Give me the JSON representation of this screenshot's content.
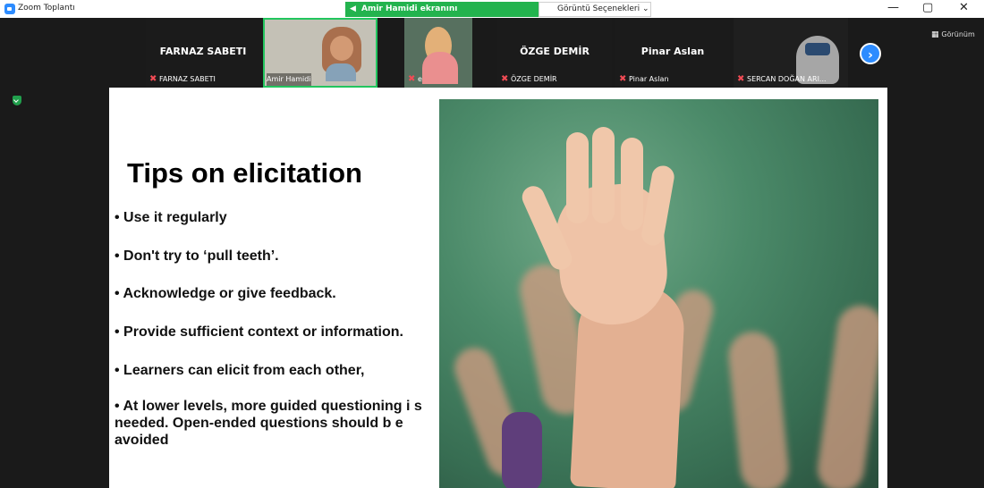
{
  "app": {
    "title": "Zoom Toplantı"
  },
  "banner": {
    "sharing_text": "Amir Hamidi ekranını görüntülüyorsunuz",
    "view_options_label": "Görüntü Seçenekleri ⌄"
  },
  "window_controls": {
    "minimize": "—",
    "restore": "▢",
    "close": "✕"
  },
  "gallery": {
    "view_label": "Görünüm",
    "tiles": [
      {
        "center_name": "FARNAZ SABETI",
        "bottom_name": "FARNAZ SABETI",
        "muted": true
      },
      {
        "center_name": "",
        "bottom_name": "Amir Hamidi",
        "muted": false,
        "speaking": true
      },
      {
        "center_name": "",
        "bottom_name": "ekrü dilek",
        "muted": true
      },
      {
        "center_name": "ÖZGE DEMİR",
        "bottom_name": "ÖZGE DEMİR",
        "muted": true
      },
      {
        "center_name": "Pinar Aslan",
        "bottom_name": "Pinar Aslan",
        "muted": true
      },
      {
        "center_name": "",
        "bottom_name": "SERCAN DOĞAN ARI...",
        "muted": true
      }
    ],
    "next_arrow": "›"
  },
  "slide": {
    "title": "Tips on elicitation",
    "bullets": [
      "• Use it regularly",
      "• Don't try to ‘pull teeth’.",
      "• Acknowledge or give feedback.",
      "• Provide sufficient context or information.",
      "• Learners can elicit from each other,",
      "• At lower levels, more guided questioning i s needed. Open-ended questions should b e avoided"
    ]
  },
  "icons": {
    "zoom": "zoom-icon",
    "secure": "shield-icon",
    "audio": "speaker-icon",
    "muted": "microphone-muted-icon",
    "next": "chevron-right-icon",
    "view": "grid-icon"
  },
  "colors": {
    "banner_green": "#23b34e",
    "zoom_blue": "#2d8cff",
    "muted_red": "#f24b55"
  }
}
